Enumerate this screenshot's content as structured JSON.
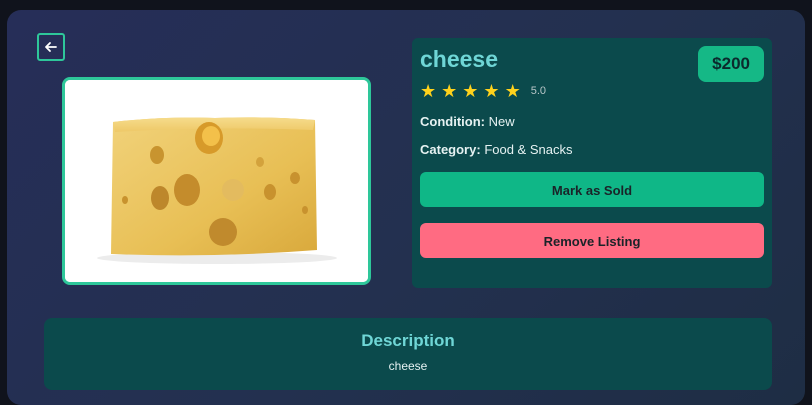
{
  "listing": {
    "title": "cheese",
    "price": "$200",
    "rating_stars": 5,
    "rating_value": "5.0",
    "condition_label": "Condition:",
    "condition_value": "New",
    "category_label": "Category:",
    "category_value": "Food & Snacks"
  },
  "actions": {
    "mark_sold": "Mark as Sold",
    "remove": "Remove Listing"
  },
  "description": {
    "heading": "Description",
    "text": "cheese"
  },
  "icons": {
    "back": "arrow-left-icon",
    "star": "star-icon"
  },
  "colors": {
    "accent": "#2ec79a",
    "panel": "#0b4a4c",
    "title": "#6fd6d6",
    "sold_button": "#0fb787",
    "remove_button": "#ff6b82",
    "star": "#ffd21c"
  }
}
